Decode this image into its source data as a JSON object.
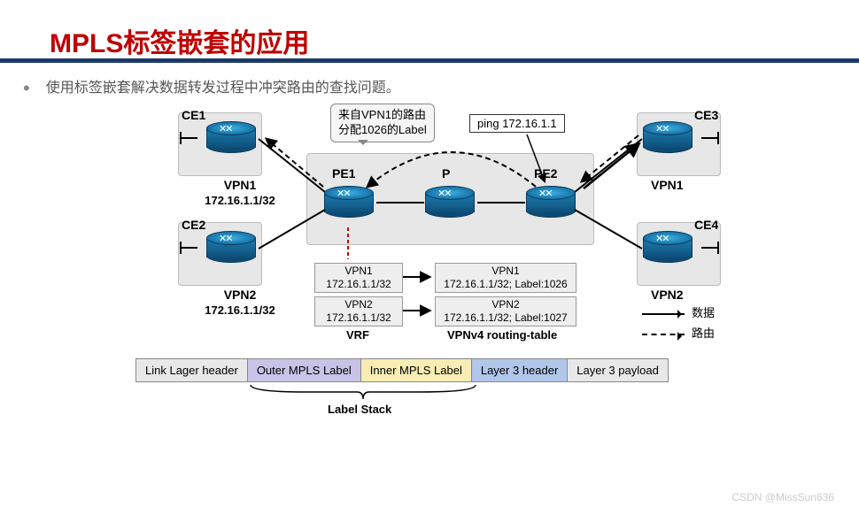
{
  "title": "MPLS标签嵌套的应用",
  "bullet": "使用标签嵌套解决数据转发过程中冲突路由的查找问题。",
  "devices": {
    "ce1": "CE1",
    "ce2": "CE2",
    "ce3": "CE3",
    "ce4": "CE4",
    "pe1": "PE1",
    "pe2": "PE2",
    "p": "P",
    "vpn1a": "VPN1",
    "vpn1a_ip": "172.16.1.1/32",
    "vpn2a": "VPN2",
    "vpn2a_ip": "172.16.1.1/32",
    "vpn1b": "VPN1",
    "vpn2b": "VPN2"
  },
  "callout": {
    "l1": "来自VPN1的路由",
    "l2": "分配1026的Label"
  },
  "ping": "ping 172.16.1.1",
  "vrf": {
    "title": "VRF",
    "b1": {
      "l1": "VPN1",
      "l2": "172.16.1.1/32"
    },
    "b2": {
      "l1": "VPN2",
      "l2": "172.16.1.1/32"
    }
  },
  "rt": {
    "title": "VPNv4 routing-table",
    "b1": {
      "l1": "VPN1",
      "l2": "172.16.1.1/32; Label:1026"
    },
    "b2": {
      "l1": "VPN2",
      "l2": "172.16.1.1/32; Label:1027"
    }
  },
  "legend": {
    "data": "数据",
    "route": "路由"
  },
  "packet": {
    "ll": "Link Lager header",
    "outer": "Outer MPLS Label",
    "inner": "Inner MPLS Label",
    "l3h": "Layer 3 header",
    "l3p": "Layer 3 payload"
  },
  "stack": "Label Stack",
  "watermark": "CSDN @MissSun636"
}
